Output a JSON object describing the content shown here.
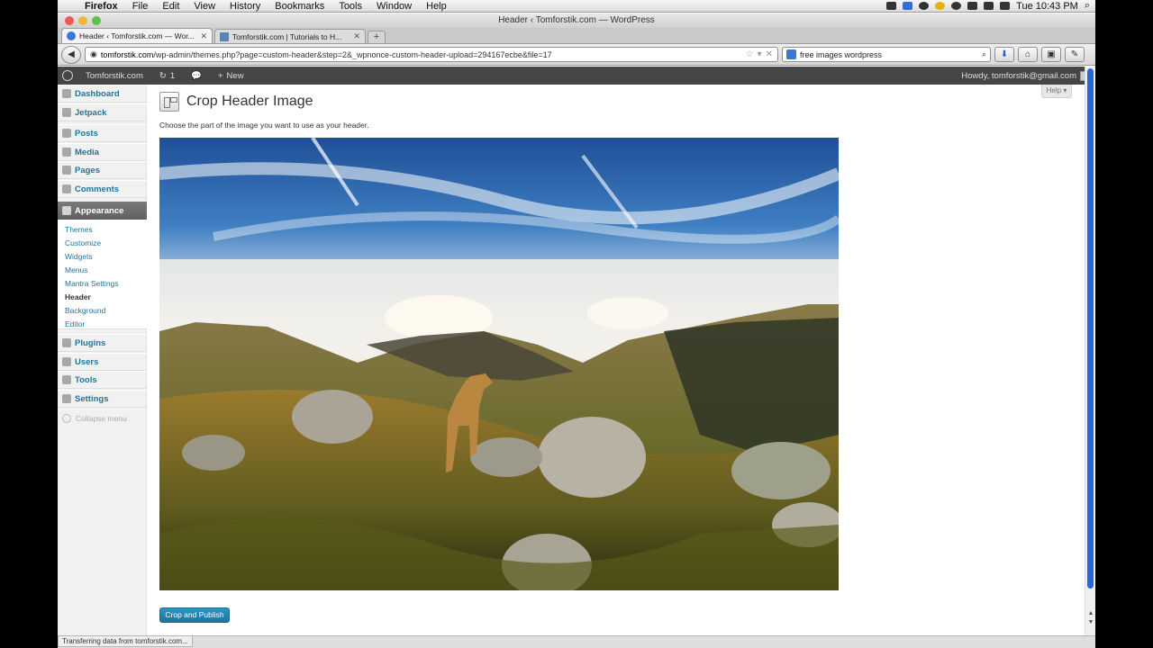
{
  "menubar": {
    "app": "Firefox",
    "items": [
      "File",
      "Edit",
      "View",
      "History",
      "Bookmarks",
      "Tools",
      "Window",
      "Help"
    ],
    "clock": "Tue 10:43 PM"
  },
  "window": {
    "title": "Header ‹ Tomforstik.com — WordPress"
  },
  "tabs": [
    {
      "label": "Header ‹ Tomforstik.com — Wor..."
    },
    {
      "label": "Tomforstik.com | Tutorials to H..."
    }
  ],
  "nav": {
    "url_domain": "tomforstik.com",
    "url_path": "/wp-admin/themes.php?page=custom-header&step=2&_wpnonce-custom-header-upload=294167ecbe&file=17",
    "search_value": "free images wordpress"
  },
  "adminbar": {
    "site": "Tomforstik.com",
    "updates": "1",
    "new": "New",
    "howdy": "Howdy, tomforstik@gmail.com"
  },
  "sidebar": {
    "items": [
      {
        "label": "Dashboard",
        "icon": "dashboard-icon"
      },
      {
        "label": "Jetpack",
        "icon": "jetpack-icon"
      },
      {
        "label": "Posts",
        "icon": "pin-icon"
      },
      {
        "label": "Media",
        "icon": "media-icon"
      },
      {
        "label": "Pages",
        "icon": "pages-icon"
      },
      {
        "label": "Comments",
        "icon": "comments-icon"
      },
      {
        "label": "Appearance",
        "icon": "appearance-icon"
      },
      {
        "label": "Plugins",
        "icon": "plugins-icon"
      },
      {
        "label": "Users",
        "icon": "users-icon"
      },
      {
        "label": "Tools",
        "icon": "tools-icon"
      },
      {
        "label": "Settings",
        "icon": "settings-icon"
      }
    ],
    "submenu": [
      "Themes",
      "Customize",
      "Widgets",
      "Menus",
      "Mantra Settings",
      "Header",
      "Background",
      "Editor"
    ],
    "collapse": "Collapse menu"
  },
  "content": {
    "help": "Help",
    "title": "Crop Header Image",
    "description": "Choose the part of the image you want to use as your header.",
    "button": "Crop and Publish"
  },
  "status": "Transferring data from tomforstik.com..."
}
